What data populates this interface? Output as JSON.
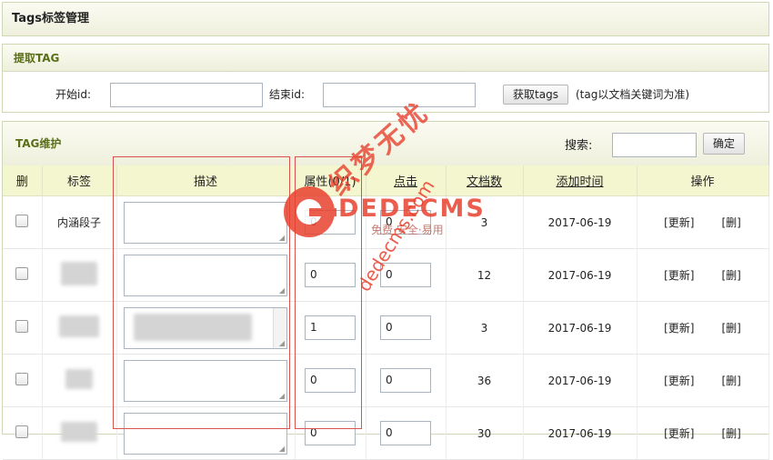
{
  "page_title": "Tags标签管理",
  "extract": {
    "title": "提取TAG",
    "start_label": "开始id:",
    "end_label": "结束id:",
    "start_value": "",
    "end_value": "",
    "fetch_button": "获取tags",
    "note": "(tag以文档关键词为准)"
  },
  "maintain": {
    "title": "TAG维护",
    "search_label": "搜索:",
    "search_value": "",
    "confirm_button": "确定"
  },
  "table": {
    "headers": {
      "del": "删",
      "tag": "标签",
      "desc": "描述",
      "attr": "属性(0/1)",
      "clicks": "点击",
      "docs": "文档数",
      "added": "添加时间",
      "ops": "操作"
    },
    "rows": [
      {
        "tag": "内涵段子",
        "attr": "0",
        "clicks": "0",
        "docs": "3",
        "date": "2017-06-19",
        "update": "[更新]",
        "delete": "[删]"
      },
      {
        "tag": "",
        "attr": "0",
        "clicks": "0",
        "docs": "12",
        "date": "2017-06-19",
        "update": "[更新]",
        "delete": "[删]"
      },
      {
        "tag": "",
        "attr": "1",
        "clicks": "0",
        "docs": "3",
        "date": "2017-06-19",
        "update": "[更新]",
        "delete": "[删]"
      },
      {
        "tag": "",
        "attr": "0",
        "clicks": "0",
        "docs": "36",
        "date": "2017-06-19",
        "update": "[更新]",
        "delete": "[删]"
      },
      {
        "tag": "",
        "attr": "0",
        "clicks": "0",
        "docs": "30",
        "date": "2017-06-19",
        "update": "[更新]",
        "delete": "[删]"
      }
    ]
  },
  "watermark": {
    "brand": "DEDECMS",
    "tagline": "免费·安全·易用",
    "domain": "dedecms.com",
    "chinese": "织梦无忧"
  },
  "colors": {
    "header_bg": "#f4f6cf",
    "section_title": "#5a6e18",
    "highlight_box": "#d9534f",
    "watermark": "#e8412e"
  }
}
